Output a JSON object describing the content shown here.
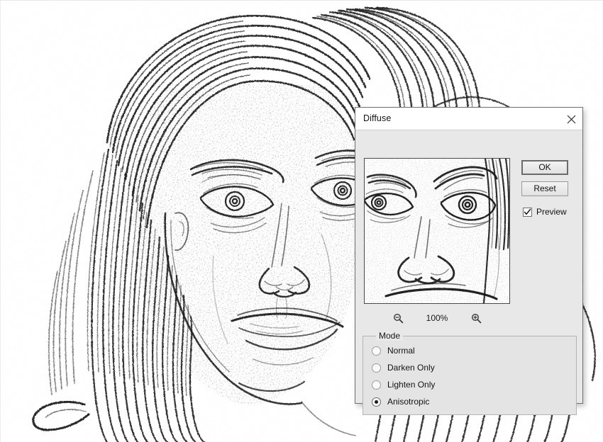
{
  "app": {
    "background_color": "#ffffff",
    "canvas_image": "pencil-sketch-portrait-of-woman-with-long-hair"
  },
  "dialog": {
    "title": "Diffuse",
    "close_icon": "close-icon",
    "preview": {
      "image": "pencil-sketch-face-closeup-eyes-nose-mouth",
      "zoom_out_icon": "zoom-out-magnifier-icon",
      "zoom_level": "100%",
      "zoom_in_icon": "zoom-in-magnifier-icon"
    },
    "buttons": {
      "ok_label": "OK",
      "reset_label": "Reset"
    },
    "preview_checkbox": {
      "label": "Preview",
      "checked": true,
      "check_icon": "checkmark-icon"
    },
    "mode": {
      "legend": "Mode",
      "options": [
        {
          "label": "Normal",
          "selected": false
        },
        {
          "label": "Darken Only",
          "selected": false
        },
        {
          "label": "Lighten Only",
          "selected": false
        },
        {
          "label": "Anisotropic",
          "selected": true
        }
      ],
      "selected_value": "Anisotropic"
    },
    "colors": {
      "dialog_background": "#e8e8e8",
      "titlebar_background": "#ffffff",
      "border": "#6f6f6f",
      "group_background": "#e4e4e4",
      "text": "#1a1a1a"
    }
  }
}
